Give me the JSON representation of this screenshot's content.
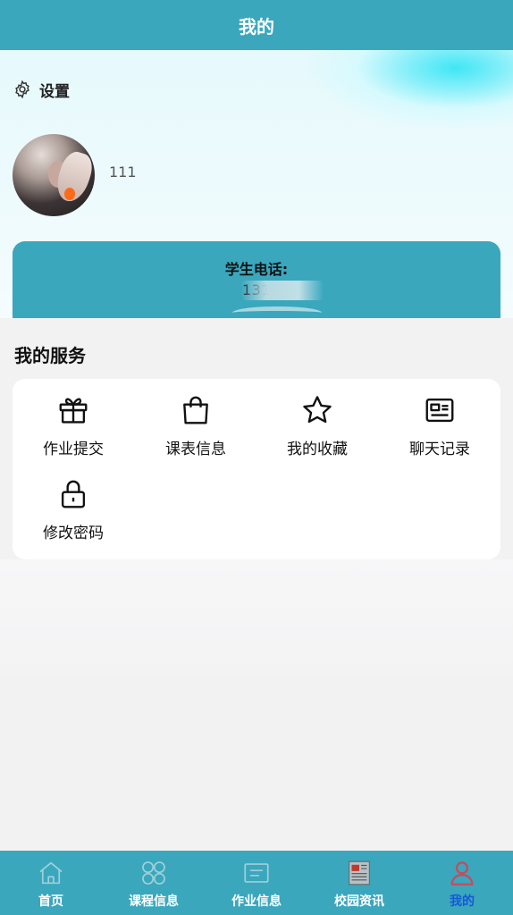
{
  "header": {
    "title": "我的"
  },
  "settings": {
    "label": "设置",
    "icon": "gear-icon"
  },
  "profile": {
    "username": "111"
  },
  "phone_card": {
    "label": "学生电话:",
    "value": "131"
  },
  "services": {
    "title": "我的服务",
    "items": [
      {
        "label": "作业提交",
        "icon": "gift-icon"
      },
      {
        "label": "课表信息",
        "icon": "shopping-bag-icon"
      },
      {
        "label": "我的收藏",
        "icon": "star-icon"
      },
      {
        "label": "聊天记录",
        "icon": "id-card-icon"
      },
      {
        "label": "修改密码",
        "icon": "lock-icon"
      }
    ]
  },
  "tabbar": {
    "active_color": "#1559d6",
    "items": [
      {
        "label": "首页",
        "icon": "home-icon",
        "active": false
      },
      {
        "label": "课程信息",
        "icon": "grid-icon",
        "active": false
      },
      {
        "label": "作业信息",
        "icon": "document-icon",
        "active": false
      },
      {
        "label": "校园资讯",
        "icon": "newspaper-icon",
        "active": false
      },
      {
        "label": "我的",
        "icon": "user-icon",
        "active": true
      }
    ]
  },
  "colors": {
    "primary": "#3aa7bd",
    "background": "#f2f2f3",
    "card": "#ffffff"
  }
}
